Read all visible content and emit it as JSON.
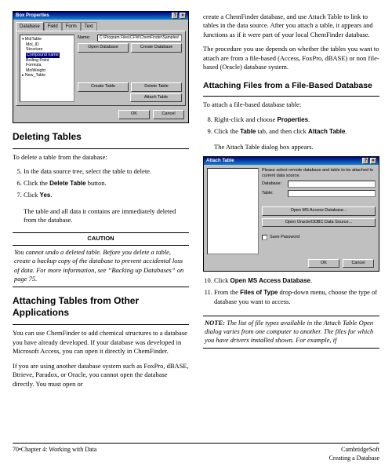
{
  "left": {
    "mock1": {
      "title": "Box Properties",
      "tabs": [
        "Database",
        "Field",
        "Form",
        "Text"
      ],
      "tree": {
        "root": "MolTable",
        "items": [
          "Mol_ID",
          "Structure",
          "Compound name",
          "Boiling Point",
          "Formula",
          "MolWeight"
        ],
        "sel": "Compound name",
        "other": "New_Table"
      },
      "nameLabel": "Name:",
      "nameValue": "C:\\Program Files\\CFW\\ChemFinder\\Samples\\",
      "buttons": {
        "open": "Open Database",
        "create": "Create Database",
        "createt": "Create Table",
        "delete": "Delete Table",
        "attach": "Attach Table"
      },
      "ok": "OK",
      "cancel": "Cancel"
    },
    "h_delete": "Deleting Tables",
    "p_delete_intro": "To delete a table from the database:",
    "steps_delete": [
      "In the data source tree, select the table to delete.",
      "Click the <b>Delete Table</b> button.",
      "Click <b>Yes</b>."
    ],
    "p_delete_result": "The table and all data it contains are immediately deleted from the database.",
    "caution_hd": "CAUTION",
    "caution_body": "You cannot undo a deleted table. Before you delete a table, create a backup copy of the database to prevent accidental loss of data. For more information, see “Backing up Databases” on page 75.",
    "h_attach": "Attaching Tables from Other Applications",
    "p_attach1": "You can use ChemFinder to add chemical structures to a database you have already developed. If your database was developed in Microsoft Access, you can open it directly in ChemFinder.",
    "p_attach2": "If you are using another database system such as FoxPro, dBASE, Btrieve, Paradox, or Oracle, you cannot open the database directly. You must open or"
  },
  "right": {
    "p_cont": "create a ChemFinder database, and use Attach Table to link to tables in the data source. After you attach a table, it appears and functions as if it were part of your local ChemFinder database.",
    "p_proc": "The procedure you use depends on whether the tables you want to attach are from a file-based (Access, FoxPro, dBASE) or non file-based (Oracle) database system.",
    "h_file": "Attaching Files from a File-Based Database",
    "p_file_intro": "To attach a file-based database table:",
    "steps_file": [
      "Right-click and choose <b>Properties</b>.",
      "Click the <b>Table</b> tab, and then click <b>Attach Table</b>."
    ],
    "p_dialog": "The Attach Table dialog box appears.",
    "mock2": {
      "title": "Attach Table",
      "msg": "Please select remote database and table to be attached to current data source.",
      "dblabel": "Database:",
      "tbllabel": "Table:",
      "btnAccess": "Open MS Access Database...",
      "btnOracle": "Open Oracle/ODBC Data Source...",
      "chk": "Save Password",
      "ok": "OK",
      "cancel": "Cancel"
    },
    "step10": "Click <b>Open MS Access Database</b>.",
    "step11": "From the <b>Files of Type</b> drop-down menu, choose the type of database you want to access.",
    "note_label": "NOTE:",
    "note_body": "The list of file types available in the Attach Table Open dialog varies from one computer to another. The files for which you have drivers installed shown. For example, if"
  },
  "footer": {
    "left": "70•Chapter 4: Working with Data",
    "right1": "CambridgeSoft",
    "right2": "Creating a Database"
  }
}
